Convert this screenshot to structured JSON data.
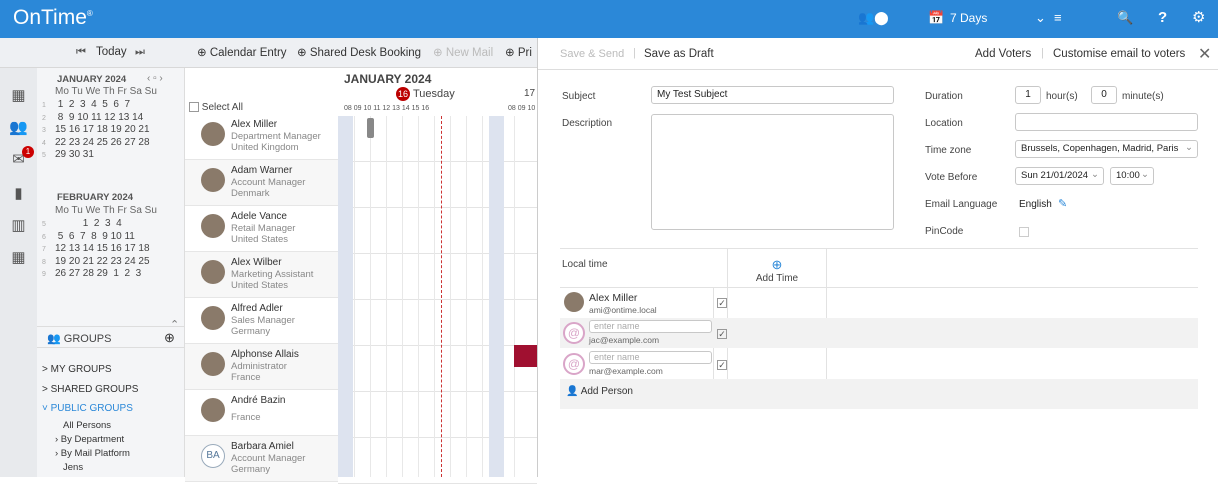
{
  "app": {
    "logo": "OnTime",
    "reg": "®"
  },
  "topbar": {
    "view": "7 Days",
    "help": "?"
  },
  "toolbar": {
    "today": "Today",
    "calendar_entry": "Calendar Entry",
    "shared_desk": "Shared Desk Booking",
    "new_mail": "New Mail",
    "pri": "Pri"
  },
  "leftnav": {
    "mail_badge": "1"
  },
  "minical": {
    "month1": "JANUARY 2024",
    "days": "Mo Tu We Th Fr Sa Su",
    "weeks1": [
      {
        "n": "1",
        "d": " 1  2  3  4  5  6  7"
      },
      {
        "n": "2",
        "d": " 8  9 10 11 12 13 14"
      },
      {
        "n": "3",
        "d": "15 16 17 18 19 20 21"
      },
      {
        "n": "4",
        "d": "22 23 24 25 26 27 28"
      },
      {
        "n": "5",
        "d": "29 30 31"
      }
    ],
    "month2": "FEBRUARY 2024",
    "weeks2": [
      {
        "n": "5",
        "d": "          1  2  3  4"
      },
      {
        "n": "6",
        "d": " 5  6  7  8  9 10 11"
      },
      {
        "n": "7",
        "d": "12 13 14 15 16 17 18"
      },
      {
        "n": "8",
        "d": "19 20 21 22 23 24 25"
      },
      {
        "n": "9",
        "d": "26 27 28 29  1  2  3"
      }
    ]
  },
  "groups": {
    "title": "GROUPS",
    "my": "> MY GROUPS",
    "shared": "> SHARED GROUPS",
    "public": "˅ PUBLIC GROUPS",
    "all": "All Persons",
    "dept": "› By Department",
    "mail": "› By Mail Platform",
    "jens": "Jens"
  },
  "people": {
    "select_all": "Select All",
    "rows": [
      {
        "name": "Alex Miller",
        "role": "Department Manager",
        "loc": "United Kingdom"
      },
      {
        "name": "Adam Warner",
        "role": "Account Manager",
        "loc": "Denmark"
      },
      {
        "name": "Adele Vance",
        "role": "Retail Manager",
        "loc": "United States"
      },
      {
        "name": "Alex Wilber",
        "role": "Marketing Assistant",
        "loc": "United States"
      },
      {
        "name": "Alfred Adler",
        "role": "Sales Manager",
        "loc": "Germany"
      },
      {
        "name": "Alphonse Allais",
        "role": "Administrator",
        "loc": "France"
      },
      {
        "name": "André Bazin",
        "role": "",
        "loc": "France"
      },
      {
        "name": "Barbara Amiel",
        "role": "Account Manager",
        "loc": "Germany",
        "initials": "BA"
      }
    ]
  },
  "timeline": {
    "month": "JANUARY 2024",
    "day_num": "16",
    "day_name": "Tuesday",
    "next_day": "17",
    "hours": "08 09 10 11 12 13 14 15 16",
    "hours2": "08 09 10"
  },
  "panel": {
    "save_send": "Save & Send",
    "save_draft": "Save as Draft",
    "add_voters": "Add Voters",
    "customise": "Customise email to voters",
    "subject_label": "Subject",
    "subject_value": "My Test Subject",
    "desc_label": "Description",
    "duration_label": "Duration",
    "hours_val": "1",
    "hours_unit": "hour(s)",
    "min_val": "0",
    "min_unit": "minute(s)",
    "location_label": "Location",
    "tz_label": "Time zone",
    "tz_value": "Brussels, Copenhagen, Madrid, Paris",
    "vote_label": "Vote Before",
    "vote_date": "Sun 21/01/2024",
    "vote_time": "10:00",
    "lang_label": "Email Language",
    "lang_value": "English",
    "pin_label": "PinCode",
    "local_time": "Local time",
    "add_time": "Add Time",
    "voters": [
      {
        "name": "Alex Miller",
        "email": "ami@ontime.local"
      },
      {
        "placeholder": "enter name",
        "email": "jac@example.com"
      },
      {
        "placeholder": "enter name",
        "email": "mar@example.com"
      }
    ],
    "add_person": "Add Person"
  }
}
